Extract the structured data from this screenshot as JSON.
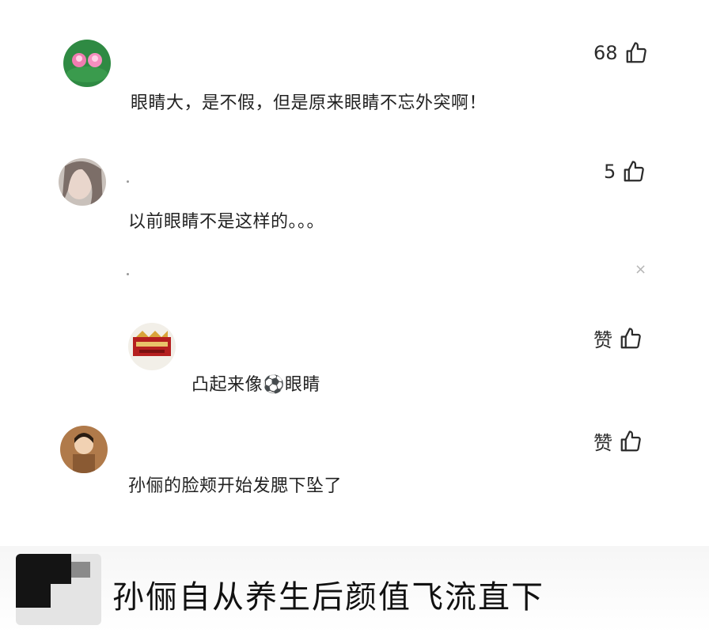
{
  "comments": [
    {
      "likes": "68",
      "text": "眼睛大，是不假，但是原来眼睛不忘外突啊！"
    },
    {
      "likes": "5",
      "text": "以前眼睛不是这样的。。。"
    },
    {
      "likes": "赞",
      "text": "凸起来像⚽眼睛"
    },
    {
      "likes": "赞",
      "text": "孙俪的脸颊开始发腮下坠了"
    }
  ],
  "banner": {
    "text": "孙俪自从养生后颜值飞流直下"
  },
  "close_symbol": "×",
  "icons": {
    "like": "thumbs-up-icon",
    "close": "close-icon"
  }
}
